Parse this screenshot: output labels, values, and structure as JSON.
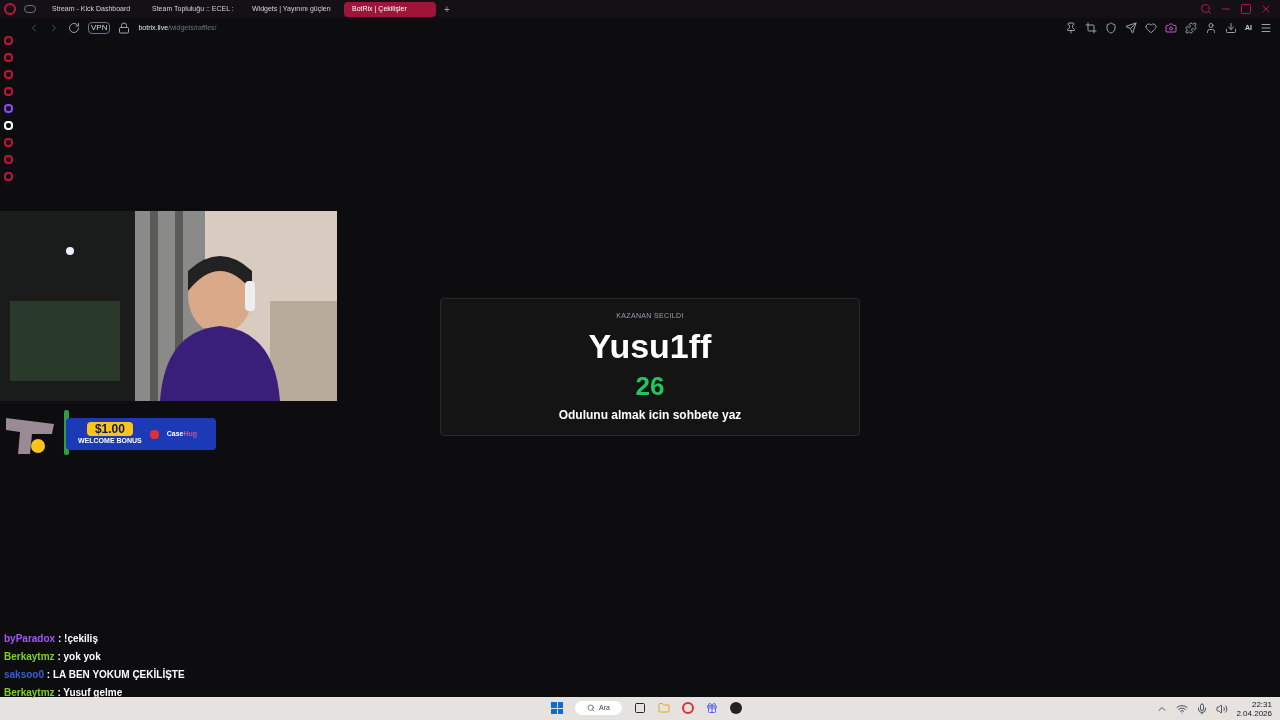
{
  "tabs": [
    {
      "title": "Stream - Kick Dashboard",
      "selected": false
    },
    {
      "title": "Steam Topluluğu :: ECEL :",
      "selected": false
    },
    {
      "title": "Widgets | Yayınını güçlen",
      "selected": false
    },
    {
      "title": "BotRix | Çekilişler",
      "selected": true
    }
  ],
  "new_tab": "+",
  "address": {
    "vpn": "VPN",
    "host": "botrix.live",
    "path": "/widgets/raffles/"
  },
  "toolbar": {
    "ai": "AI"
  },
  "winner": {
    "label": "KAZANAN SECILDI",
    "name": "Yusu1ff",
    "count": "26",
    "message": "Odulunu almak icin sohbete yaz"
  },
  "banner": {
    "amount": "$1.00",
    "text": "WELCOME BONUS",
    "brand_a": "Case",
    "brand_b": "Hug"
  },
  "chat": [
    {
      "user": "byParadox",
      "separator": ":",
      "message": "!çekiliş",
      "color": "#a855f7"
    },
    {
      "user": "Berkaytmz",
      "separator": ":",
      "message": "yok yok",
      "color": "#7ed321"
    },
    {
      "user": "saksoo0",
      "separator": ":",
      "message": "LA BEN YOKUM ÇEKİLİŞTE",
      "color": "#3b5bdb"
    },
    {
      "user": "Berkaytmz",
      "separator": ":",
      "message": "Yusuf gelme",
      "color": "#7ed321"
    }
  ],
  "taskbar": {
    "search": "Ara",
    "time": "22:31",
    "date": "2.04.2026"
  }
}
